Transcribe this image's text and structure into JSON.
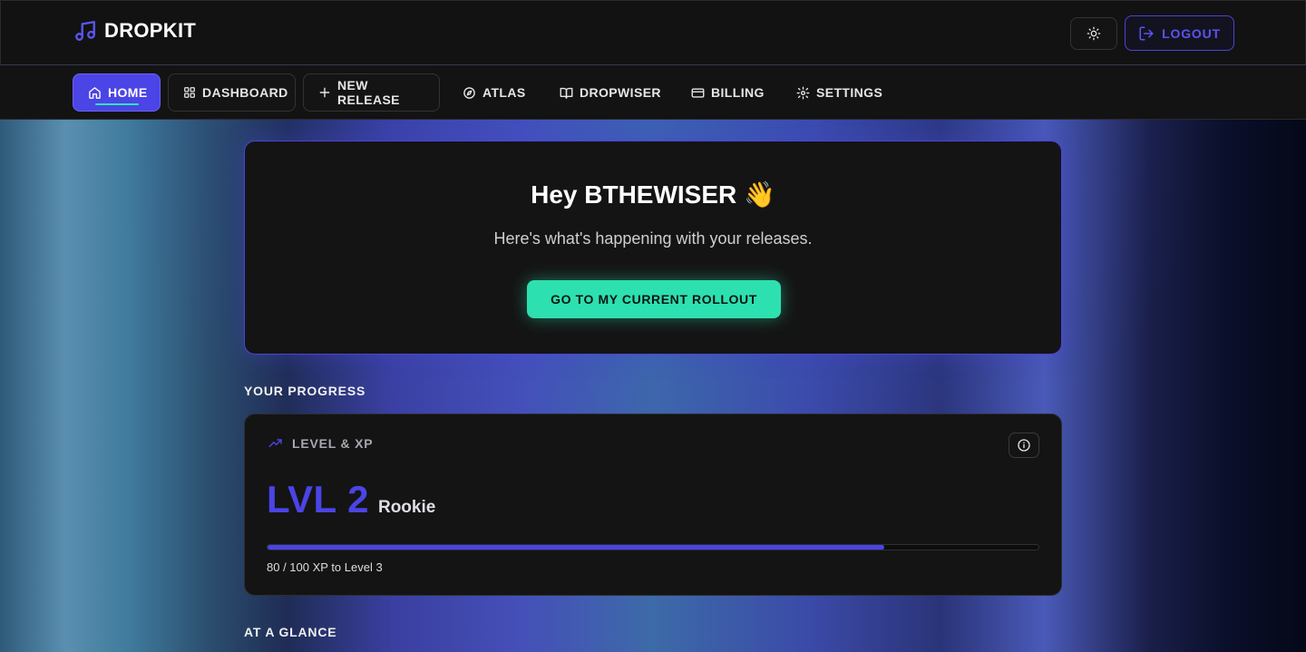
{
  "app": {
    "name": "DROPKIT",
    "logo_icon": "music-note-icon",
    "accent": "#4b44e6",
    "cta_color": "#2de0b0"
  },
  "topbar": {
    "theme_icon": "sun-icon",
    "logout_icon": "logout-icon",
    "logout_label": "LOGOUT"
  },
  "nav": {
    "items": [
      {
        "label": "HOME",
        "icon": "home-icon",
        "active": true
      },
      {
        "label": "DASHBOARD",
        "icon": "grid-icon",
        "active": false
      },
      {
        "label": "NEW RELEASE",
        "icon": "plus-icon",
        "active": false
      },
      {
        "label": "ATLAS",
        "icon": "compass-icon",
        "active": false
      },
      {
        "label": "DROPWISER",
        "icon": "book-icon",
        "active": false
      },
      {
        "label": "BILLING",
        "icon": "credit-card-icon",
        "active": false
      },
      {
        "label": "SETTINGS",
        "icon": "gear-icon",
        "active": false
      }
    ]
  },
  "hero": {
    "title": "Hey BTHEWISER 👋",
    "subtitle": "Here's what's happening with your releases.",
    "cta_label": "GO TO MY CURRENT ROLLOUT"
  },
  "progress": {
    "section_label": "YOUR PROGRESS",
    "card_title": "LEVEL & XP",
    "card_icon": "trending-up-icon",
    "info_icon": "info-icon",
    "level_label": "LVL 2",
    "rank": "Rookie",
    "xp_current": 80,
    "xp_max": 100,
    "xp_text": "80 / 100 XP to Level 3"
  },
  "glance": {
    "section_label": "AT A GLANCE"
  }
}
